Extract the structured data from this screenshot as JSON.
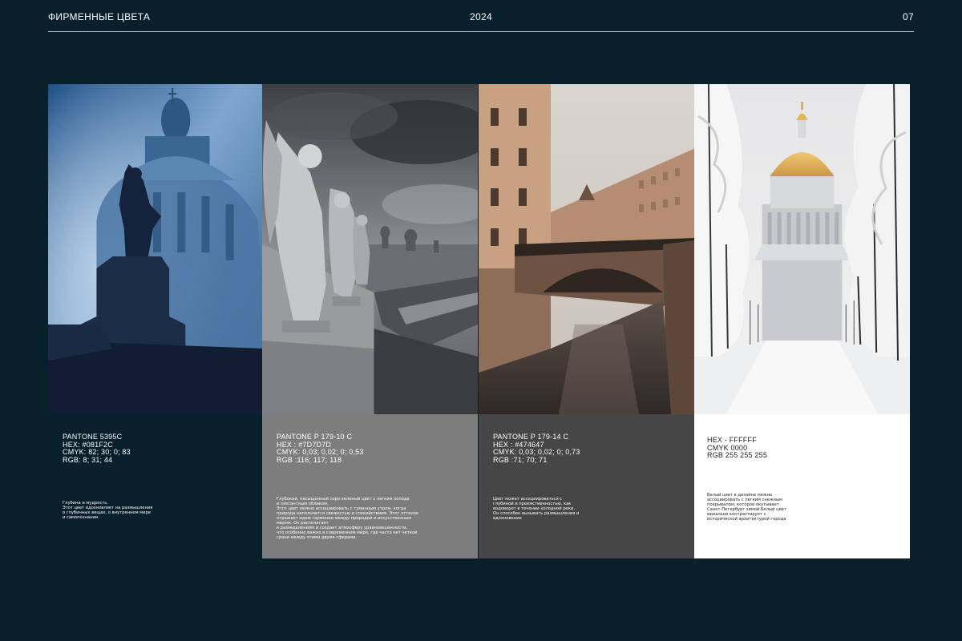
{
  "header": {
    "title": "ФИРМЕННЫЕ ЦВЕТА",
    "year": "2024",
    "page": "07"
  },
  "panels": [
    {
      "image": "statue-cathedral-blue-photo",
      "color": "#081F2C",
      "specs": [
        "PANTONE 5395C",
        "HEX: #081F2C",
        "CMYK:  82; 30; 0; 83",
        "RGB: 8; 31; 44"
      ],
      "description": "Глубина и мудрость.\nЭтот цвет вдохновляет на размышления\nо глубинных вещах, о внутреннем мире\nи самопознании."
    },
    {
      "image": "angel-statues-cloudy-city-photo",
      "color": "#7D7D7D",
      "specs": [
        "PANTONE P 179-10 C",
        "HEX : #7D7D7D",
        "CMYK:  0,03; 0,02; 0; 0,53",
        "RGB :116; 117; 118"
      ],
      "description": "Глубокий, насыщенный серо-зеленый цвет с легким холода\nи элегантным обликом.\nЭтот цвет можно ассоциировать с туманным утром, когда\nприрода наполняется свежестью и спокойствием. Этот оттенок\nотражает идею гармонии между природой и искусственным\nмиром. Он располагает\nк размышлениям и создает атмосферу уравновешенности,\nчто особенно важно в современном мире, где часто нет четкой\nграни между этими двумя сферами."
    },
    {
      "image": "canal-bridge-photo",
      "color": "#474647",
      "specs": [
        "PANTONE P 179-14 C",
        "HEX : #474647",
        "CMYK:  0,03; 0,02; 0; 0,73",
        "RGB :71; 70; 71"
      ],
      "description": "Цвет может ассоциироваться с\nглубиной и преемственностью, как\nводоворот в течении холодной реки.\nОн способен вызывать размышления и\nвдохновение"
    },
    {
      "image": "snowy-cathedral-photo",
      "color": "#FFFFFF",
      "specs": [
        "HEX - FFFFFF",
        "CMYK 0000",
        "RGB 255 255 255"
      ],
      "description": "Белый цвет в дизайне можно\nассоциировать с легким снежным\nпокрывалом, которое окутывает\nСанкт-Петербург зимой.Белый цвет\nидеально контрастирует с\nисторической архитектурой города"
    }
  ]
}
